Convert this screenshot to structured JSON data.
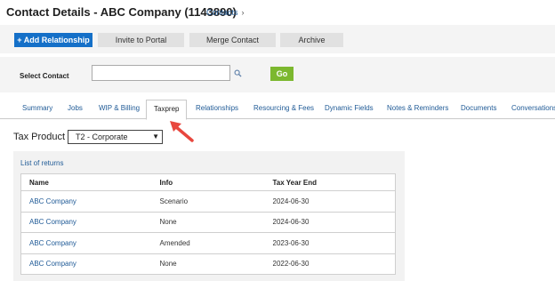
{
  "header": {
    "title": "Contact Details - ABC Company (1143890)",
    "breadcrumb": "Contacts",
    "breadcrumb_chevron": "›"
  },
  "actions": {
    "add_relationship": "+ Add Relationship",
    "invite_portal": "Invite to Portal",
    "merge_contact": "Merge Contact",
    "archive": "Archive"
  },
  "select_contact": {
    "label": "Select Contact",
    "value": "",
    "go": "Go"
  },
  "tabs": [
    {
      "label": "Summary"
    },
    {
      "label": "Jobs"
    },
    {
      "label": "WIP & Billing"
    },
    {
      "label": "Taxprep"
    },
    {
      "label": "Relationships"
    },
    {
      "label": "Resourcing & Fees"
    },
    {
      "label": "Dynamic Fields"
    },
    {
      "label": "Notes & Reminders"
    },
    {
      "label": "Documents"
    },
    {
      "label": "Conversations"
    }
  ],
  "active_tab": "Taxprep",
  "tax_product": {
    "label": "Tax Product",
    "selected": "T2 - Corporate"
  },
  "returns": {
    "title": "List of returns",
    "columns": [
      "Name",
      "Info",
      "Tax Year End"
    ],
    "rows": [
      [
        "ABC Company",
        "Scenario",
        "2024-06-30"
      ],
      [
        "ABC Company",
        "None",
        "2024-06-30"
      ],
      [
        "ABC Company",
        "Amended",
        "2023-06-30"
      ],
      [
        "ABC Company",
        "None",
        "2022-06-30"
      ]
    ]
  },
  "colors": {
    "primary": "#1570c8",
    "go": "#7cb82f",
    "link": "#1f5a96",
    "annotation_arrow": "#e8473e"
  }
}
